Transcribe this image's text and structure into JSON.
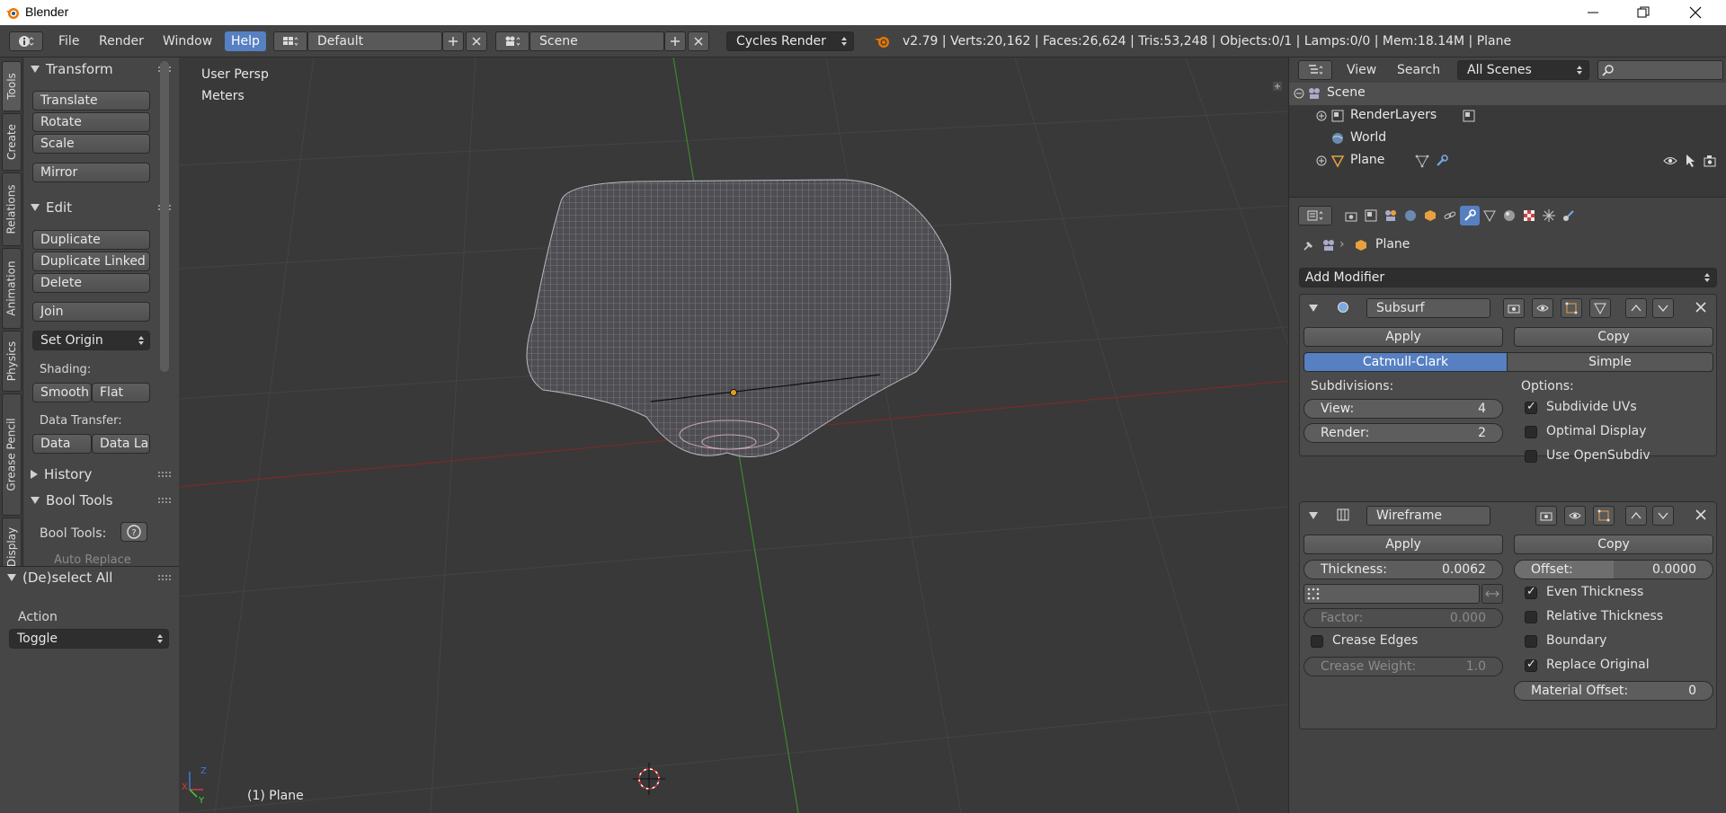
{
  "window": {
    "title": "Blender"
  },
  "infobar": {
    "menus": [
      "File",
      "Render",
      "Window",
      "Help"
    ],
    "layout": "Default",
    "scene": "Scene",
    "engine": "Cycles Render",
    "stats": "v2.79 | Verts:20,162 | Faces:26,624 | Tris:53,248 | Objects:0/1 | Lamps:0/0 | Mem:18.14M | Plane"
  },
  "toolshelf": {
    "tabs": [
      "Tools",
      "Create",
      "Relations",
      "Animation",
      "Physics",
      "Grease Pencil",
      "Display"
    ],
    "transform": {
      "title": "Transform",
      "buttons": [
        "Translate",
        "Rotate",
        "Scale",
        "Mirror"
      ]
    },
    "edit": {
      "title": "Edit",
      "buttons": [
        "Duplicate",
        "Duplicate Linked",
        "Delete",
        "Join"
      ],
      "set_origin": "Set Origin",
      "shading_label": "Shading:",
      "smooth": "Smooth",
      "flat": "Flat",
      "data_transfer_label": "Data Transfer:",
      "data": "Data",
      "data_la": "Data La"
    },
    "history": "History",
    "bool_tools": {
      "title": "Bool Tools",
      "label": "Bool Tools:",
      "auto_replace": "Auto Replace"
    }
  },
  "operator": {
    "title": "(De)select All",
    "action_label": "Action",
    "action_value": "Toggle"
  },
  "viewport": {
    "view_name": "User Persp",
    "units": "Meters",
    "object_label": "(1) Plane"
  },
  "outliner": {
    "view": "View",
    "search": "Search",
    "filter": "All Scenes",
    "rows": [
      "Scene",
      "RenderLayers",
      "World",
      "Plane"
    ]
  },
  "properties": {
    "context": "Plane",
    "add_modifier": "Add Modifier",
    "subsurf": {
      "name": "Subsurf",
      "apply": "Apply",
      "copy": "Copy",
      "mode_a": "Catmull-Clark",
      "mode_b": "Simple",
      "subdivisions_label": "Subdivisions:",
      "options_label": "Options:",
      "view_label": "View:",
      "view_value": "4",
      "render_label": "Render:",
      "render_value": "2",
      "subdivide_uvs": "Subdivide UVs",
      "optimal_display": "Optimal Display",
      "use_opensubdiv": "Use OpenSubdiv"
    },
    "wireframe": {
      "name": "Wireframe",
      "apply": "Apply",
      "copy": "Copy",
      "thickness_label": "Thickness:",
      "thickness_value": "0.0062",
      "offset_label": "Offset:",
      "offset_value": "0.0000",
      "factor_label": "Factor:",
      "factor_value": "0.000",
      "crease_edges": "Crease Edges",
      "crease_weight_label": "Crease Weight:",
      "crease_weight_value": "1.0",
      "even_thickness": "Even Thickness",
      "relative_thickness": "Relative Thickness",
      "boundary": "Boundary",
      "replace_original": "Replace Original",
      "material_offset_label": "Material Offset:",
      "material_offset_value": "0"
    }
  },
  "colors": {
    "accent": "#5680c2",
    "background": "#393939"
  }
}
